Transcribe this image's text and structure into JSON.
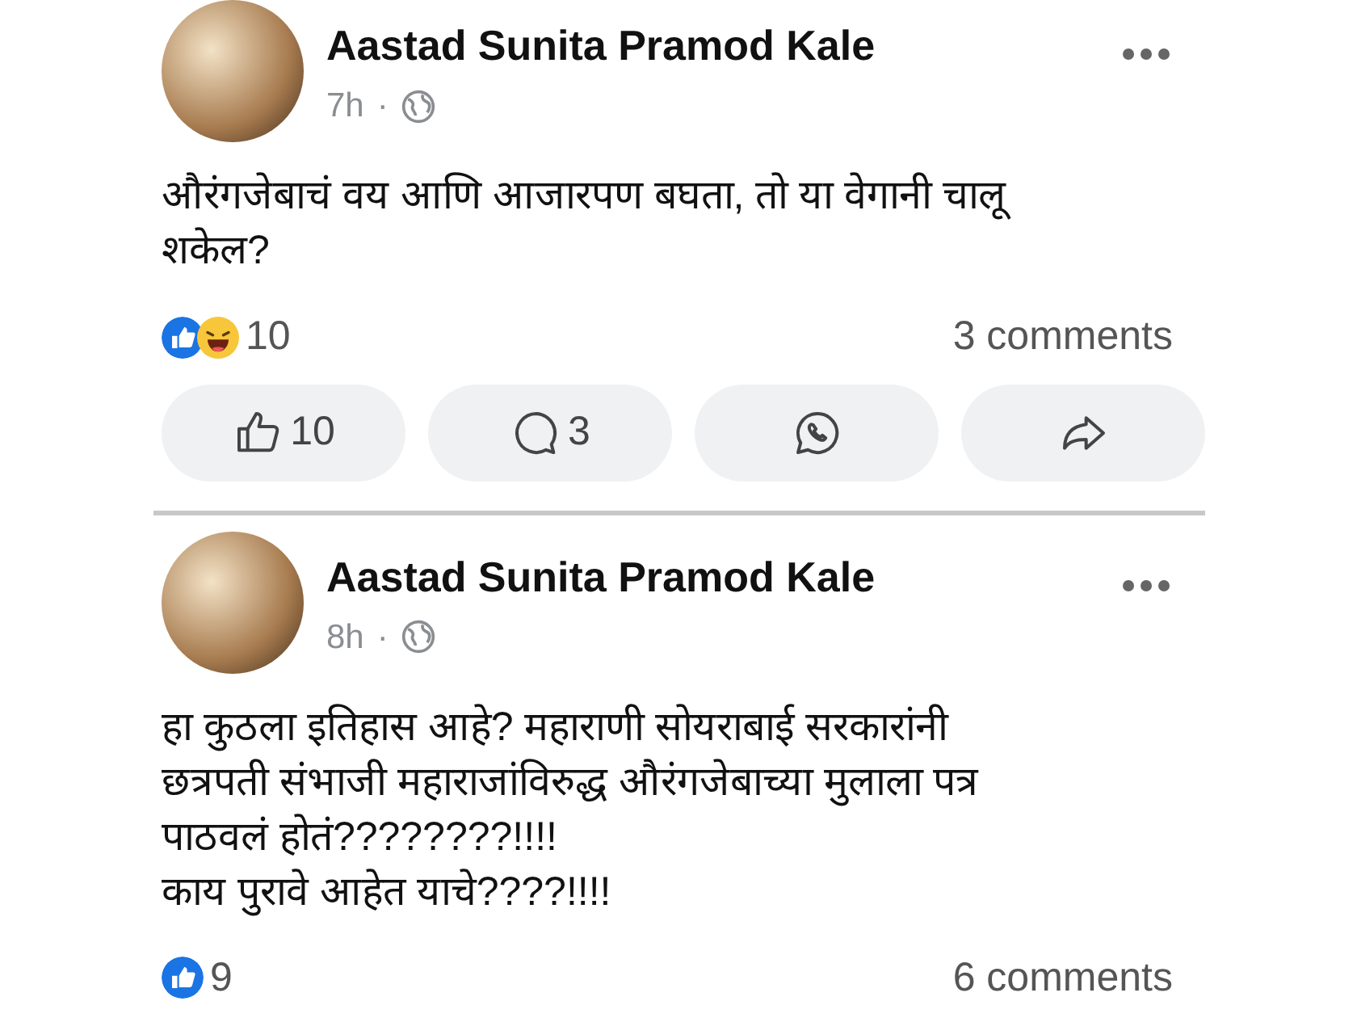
{
  "posts": [
    {
      "author": "Aastad Sunita Pramod Kale",
      "time": "7h",
      "separator": "·",
      "text": "औरंगजेबाचं वय आणि आजारपण बघता, तो या वेगानी चालू शकेल?",
      "reactions": [
        {
          "kind": "like"
        },
        {
          "kind": "haha"
        }
      ],
      "reaction_count": "10",
      "comments": "3 comments",
      "actions": [
        {
          "kind": "like",
          "count": "10"
        },
        {
          "kind": "comment",
          "count": "3"
        },
        {
          "kind": "whatsapp"
        },
        {
          "kind": "share"
        }
      ]
    },
    {
      "author": "Aastad Sunita Pramod Kale",
      "time": "8h",
      "separator": "·",
      "text": "हा कुठला इतिहास आहे? महाराणी सोयराबाई सरकारांनी छत्रपती संभाजी महाराजांविरुद्ध औरंगजेबाच्या मुलाला पत्र पाठवलं होतं????????!!!!\nकाय पुरावे आहेत याचे????!!!!",
      "reactions": [
        {
          "kind": "like"
        }
      ],
      "reaction_count": "9",
      "comments": "6 comments"
    }
  ]
}
